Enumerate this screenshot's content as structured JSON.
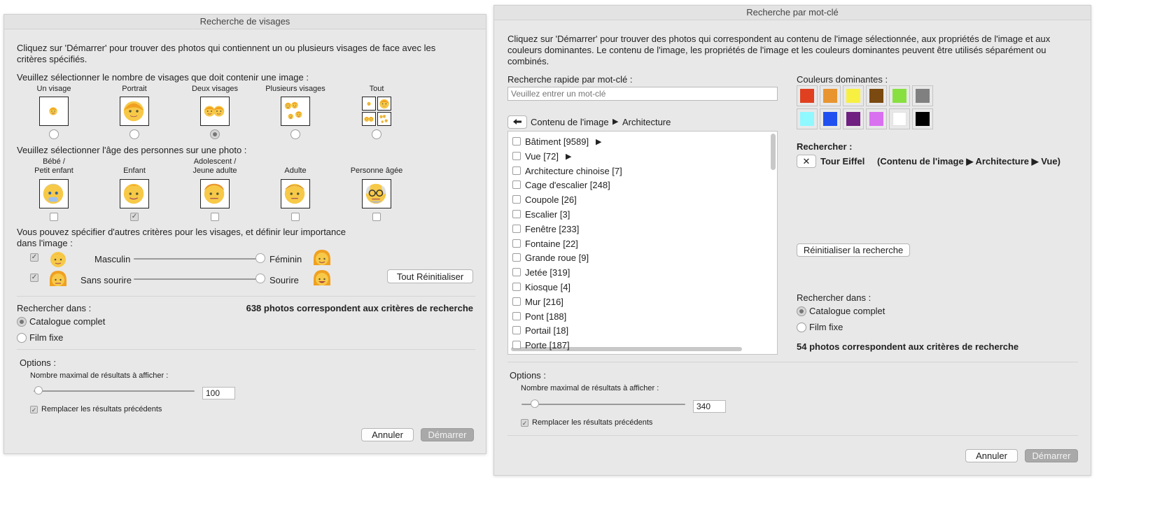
{
  "face_dialog": {
    "title": "Recherche de visages",
    "intro": "Cliquez sur 'Démarrer' pour trouver des photos qui contiennent un ou plusieurs visages de face avec les critères spécifiés.",
    "count_prompt": "Veuillez sélectionner le nombre de visages que doit contenir une image :",
    "count_options": [
      {
        "label": "Un visage",
        "selected": false
      },
      {
        "label": "Portrait",
        "selected": false
      },
      {
        "label": "Deux visages",
        "selected": true
      },
      {
        "label": "Plusieurs visages",
        "selected": false
      },
      {
        "label": "Tout",
        "selected": false
      }
    ],
    "age_prompt": "Veuillez sélectionner l'âge des personnes sur une photo :",
    "age_options": [
      {
        "label_line1": "Bébé /",
        "label_line2": "Petit enfant",
        "checked": false
      },
      {
        "label_line1": "",
        "label_line2": "Enfant",
        "checked": true
      },
      {
        "label_line1": "Adolescent /",
        "label_line2": "Jeune adulte",
        "checked": false
      },
      {
        "label_line1": "",
        "label_line2": "Adulte",
        "checked": false
      },
      {
        "label_line1": "",
        "label_line2": "Personne âgée",
        "checked": false
      }
    ],
    "criteria_prompt_line1": "Vous pouvez spécifier d'autres critères pour les visages, et définir leur importance",
    "criteria_prompt_line2": "dans l'image :",
    "criteria": [
      {
        "left": "Masculin",
        "right": "Féminin",
        "checked": true,
        "value": 1.0
      },
      {
        "left": "Sans sourire",
        "right": "Sourire",
        "checked": true,
        "value": 1.0
      }
    ],
    "reset_all": "Tout Réinitialiser",
    "search_in_label": "Rechercher dans :",
    "search_in_options": [
      {
        "label": "Catalogue complet",
        "selected": true
      },
      {
        "label": "Film fixe",
        "selected": false
      }
    ],
    "result_count": "638 photos correspondent aux critères de recherche",
    "options_label": "Options :",
    "max_results_label": "Nombre maximal de résultats à afficher :",
    "max_results_value": "100",
    "max_results_slider": 0.03,
    "replace_label": "Remplacer les résultats précédents",
    "replace_checked": true,
    "cancel": "Annuler",
    "start": "Démarrer"
  },
  "keyword_dialog": {
    "title": "Recherche par mot-clé",
    "intro_line1": "Cliquez sur 'Démarrer' pour trouver des photos qui correspondent au contenu de l'image sélectionnée, aux propriétés de l'image et aux",
    "intro_line2": "couleurs dominantes. Le contenu de l'image, les propriétés de l'image et les couleurs dominantes peuvent être utilisés séparément ou",
    "intro_line3": "combinés.",
    "quick_search_label": "Recherche rapide par mot-clé :",
    "quick_search_placeholder": "Veuillez entrer un mot-clé",
    "breadcrumb": {
      "root": "Contenu de l'image",
      "current": "Architecture"
    },
    "keywords": [
      {
        "label": "Bâtiment [9589]",
        "has_children": true
      },
      {
        "label": "Vue [72]",
        "has_children": true
      },
      {
        "label": "Architecture chinoise [7]",
        "has_children": false
      },
      {
        "label": "Cage d'escalier [248]",
        "has_children": false
      },
      {
        "label": "Coupole [26]",
        "has_children": false
      },
      {
        "label": "Escalier [3]",
        "has_children": false
      },
      {
        "label": "Fenêtre [233]",
        "has_children": false
      },
      {
        "label": "Fontaine [22]",
        "has_children": false
      },
      {
        "label": "Grande roue [9]",
        "has_children": false
      },
      {
        "label": "Jetée [319]",
        "has_children": false
      },
      {
        "label": "Kiosque [4]",
        "has_children": false
      },
      {
        "label": "Mur [216]",
        "has_children": false
      },
      {
        "label": "Pont [188]",
        "has_children": false
      },
      {
        "label": "Portail [18]",
        "has_children": false
      },
      {
        "label": "Porte [187]",
        "has_children": false
      }
    ],
    "colors_label": "Couleurs dominantes :",
    "colors": [
      "#e04020",
      "#e89530",
      "#f8f040",
      "#7a4a10",
      "#88e040",
      "#808080",
      "#90f8ff",
      "#2050f0",
      "#702080",
      "#d870f0",
      "#ffffff",
      "#000000"
    ],
    "search_for_label": "Rechercher :",
    "search_term_name": "Tour Eiffel",
    "search_term_path": "(Contenu de l'image ▶ Architecture ▶ Vue)",
    "reset_search": "Réinitialiser la recherche",
    "search_in_label": "Rechercher dans :",
    "search_in_options": [
      {
        "label": "Catalogue complet",
        "selected": true
      },
      {
        "label": "Film fixe",
        "selected": false
      }
    ],
    "result_count": "54 photos correspondent aux critères de recherche",
    "options_label": "Options :",
    "max_results_label": "Nombre maximal de résultats à afficher :",
    "max_results_value": "340",
    "max_results_slider": 0.08,
    "replace_label": "Remplacer les résultats précédents",
    "replace_checked": true,
    "cancel": "Annuler",
    "start": "Démarrer"
  }
}
